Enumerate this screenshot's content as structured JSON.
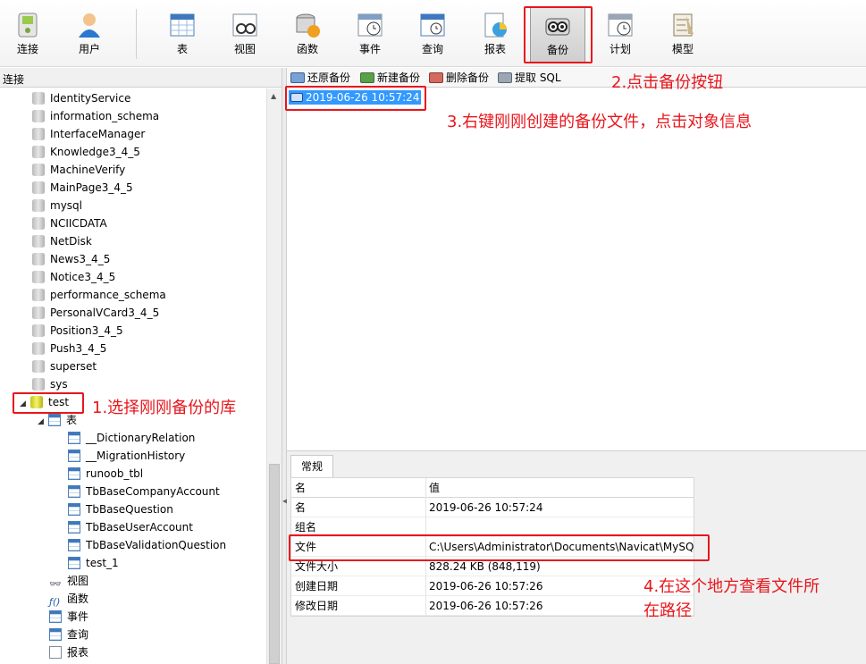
{
  "toolbar": {
    "buttons": [
      {
        "label": "连接",
        "icon": "connection-icon"
      },
      {
        "label": "用户",
        "icon": "user-icon"
      },
      {
        "label": "表",
        "icon": "table-icon"
      },
      {
        "label": "视图",
        "icon": "view-icon"
      },
      {
        "label": "函数",
        "icon": "function-icon"
      },
      {
        "label": "事件",
        "icon": "event-icon"
      },
      {
        "label": "查询",
        "icon": "query-icon"
      },
      {
        "label": "报表",
        "icon": "report-icon"
      },
      {
        "label": "备份",
        "icon": "backup-icon"
      },
      {
        "label": "计划",
        "icon": "schedule-icon"
      },
      {
        "label": "模型",
        "icon": "model-icon"
      }
    ]
  },
  "left_pane": {
    "header": "连接",
    "databases": [
      "IdentityService",
      "information_schema",
      "InterfaceManager",
      "Knowledge3_4_5",
      "MachineVerify",
      "MainPage3_4_5",
      "mysql",
      "NCIICDATA",
      "NetDisk",
      "News3_4_5",
      "Notice3_4_5",
      "performance_schema",
      "PersonalVCard3_4_5",
      "Position3_4_5",
      "Push3_4_5",
      "superset",
      "sys"
    ],
    "selected_db": "test",
    "tables_label": "表",
    "tables": [
      "__DictionaryRelation",
      "__MigrationHistory",
      "runoob_tbl",
      "TbBaseCompanyAccount",
      "TbBaseQuestion",
      "TbBaseUserAccount",
      "TbBaseValidationQuestion",
      "test_1"
    ],
    "other_nodes": [
      {
        "label": "视图",
        "icon": "glasses-icon"
      },
      {
        "label": "函数",
        "icon": "function-icon"
      },
      {
        "label": "事件",
        "icon": "event-icon"
      },
      {
        "label": "查询",
        "icon": "query-icon"
      },
      {
        "label": "报表",
        "icon": "report-icon"
      }
    ]
  },
  "right_toolbar": {
    "restore": "还原备份",
    "new": "新建备份",
    "delete": "删除备份",
    "extract": "提取 SQL"
  },
  "backup_list": {
    "items": [
      "2019-06-26 10:57:24"
    ]
  },
  "info": {
    "tab": "常规",
    "header_key": "名",
    "header_value": "值",
    "rows": [
      {
        "k": "名",
        "v": "2019-06-26 10:57:24"
      },
      {
        "k": "组名",
        "v": ""
      },
      {
        "k": "文件",
        "v": "C:\\Users\\Administrator\\Documents\\Navicat\\MySQL"
      },
      {
        "k": "文件大小",
        "v": "828.24 KB (848,119)"
      },
      {
        "k": "创建日期",
        "v": "2019-06-26 10:57:26"
      },
      {
        "k": "修改日期",
        "v": "2019-06-26 10:57:26"
      }
    ]
  },
  "annotations": {
    "a1": "1.选择刚刚备份的库",
    "a2": "2.点击备份按钮",
    "a3": "3.右键刚刚创建的备份文件，点击对象信息",
    "a4_line1": "4.在这个地方查看文件所",
    "a4_line2": "在路径"
  },
  "colors": {
    "annotation": "#e8161c",
    "selection": "#3399ff"
  }
}
